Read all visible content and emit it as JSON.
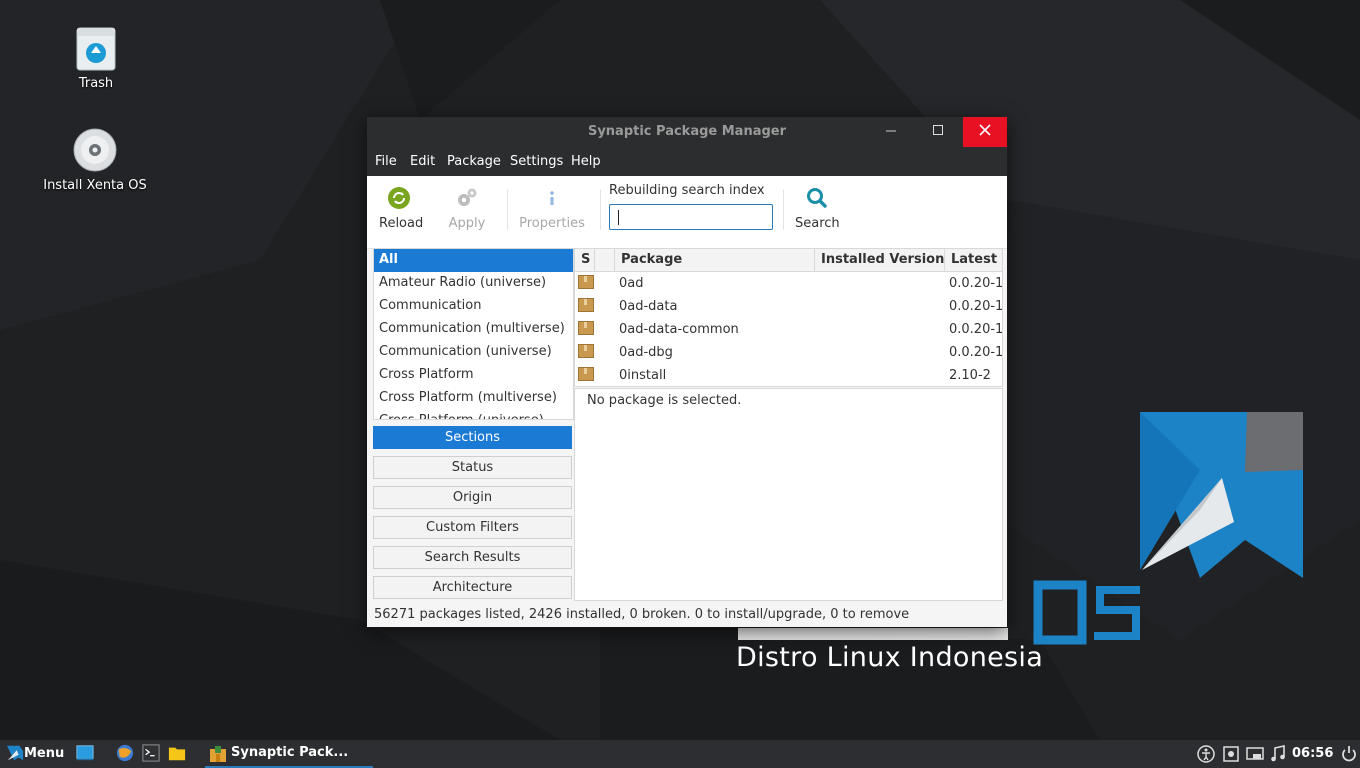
{
  "desktop": {
    "icons": [
      {
        "label": "Trash"
      },
      {
        "label": "Install Xenta OS"
      }
    ],
    "brand_text": "Distro Linux Indonesia"
  },
  "window": {
    "title": "Synaptic Package Manager",
    "menu": [
      "File",
      "Edit",
      "Package",
      "Settings",
      "Help"
    ],
    "toolbar": {
      "reload": "Reload",
      "apply": "Apply",
      "properties": "Properties",
      "search_label": "Rebuilding search index",
      "search_value": "",
      "search": "Search"
    },
    "sections": [
      "All",
      "Amateur Radio (universe)",
      "Communication",
      "Communication (multiverse)",
      "Communication (universe)",
      "Cross Platform",
      "Cross Platform (multiverse)",
      "Cross Platform (universe)"
    ],
    "filters": [
      "Sections",
      "Status",
      "Origin",
      "Custom Filters",
      "Search Results",
      "Architecture"
    ],
    "table": {
      "columns": [
        "S",
        "",
        "Package",
        "Installed Version",
        "Latest V"
      ],
      "rows": [
        {
          "package": "0ad",
          "installed": "",
          "latest": "0.0.20-1"
        },
        {
          "package": "0ad-data",
          "installed": "",
          "latest": "0.0.20-1"
        },
        {
          "package": "0ad-data-common",
          "installed": "",
          "latest": "0.0.20-1"
        },
        {
          "package": "0ad-dbg",
          "installed": "",
          "latest": "0.0.20-1"
        },
        {
          "package": "0install",
          "installed": "",
          "latest": "2.10-2"
        }
      ]
    },
    "details": "No package is selected.",
    "status": "56271 packages listed, 2426 installed, 0 broken. 0 to install/upgrade, 0 to remove"
  },
  "taskbar": {
    "menu_label": "Menu",
    "task_label": "Synaptic Pack...",
    "clock": "06:56"
  },
  "colors": {
    "accent": "#1a7ad4",
    "close": "#e81123",
    "titlebar": "#2b2d2f"
  }
}
